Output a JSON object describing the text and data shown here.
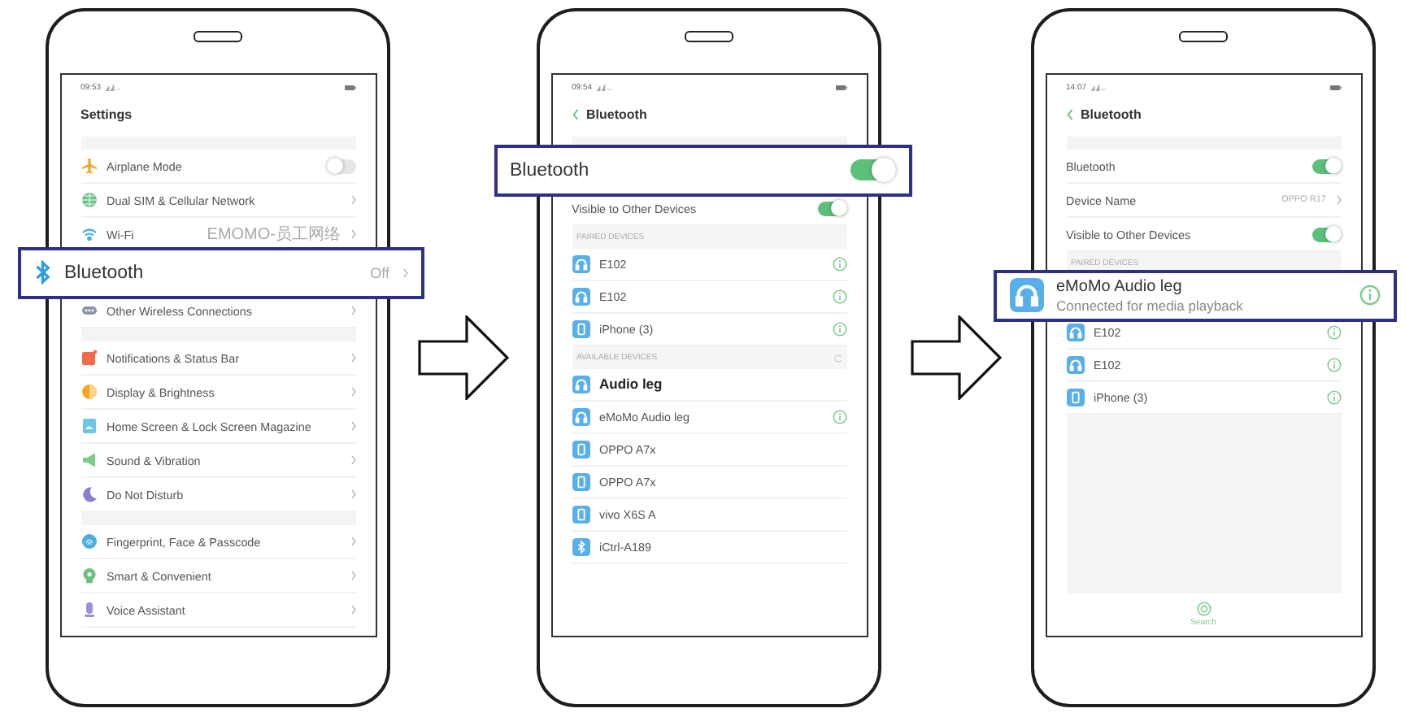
{
  "phones": [
    {
      "status_time": "09:53",
      "header": {
        "kind": "title",
        "title": "Settings"
      },
      "groups": [
        {
          "rows": [
            {
              "kind": "setting",
              "label": "Airplane Mode",
              "on": false
            },
            {
              "kind": "setting",
              "label": "Dual SIM & Cellular Network"
            },
            {
              "kind": "setting",
              "label": "Wi-Fi",
              "value": "EMOMO-员工网络"
            },
            {
              "kind": "bluetooth",
              "label": "Bluetooth",
              "value": "Off",
              "highlighted": true
            },
            {
              "kind": "setting",
              "label": "Other Wireless Connections"
            }
          ]
        },
        {
          "rows": [
            {
              "kind": "setting",
              "label": "Notifications & Status Bar"
            },
            {
              "kind": "setting",
              "label": "Display & Brightness"
            },
            {
              "kind": "setting",
              "label": "Home Screen & Lock Screen Magazine"
            },
            {
              "kind": "setting",
              "label": "Sound & Vibration"
            },
            {
              "kind": "setting",
              "label": "Do Not Disturb"
            }
          ]
        },
        {
          "rows": [
            {
              "kind": "setting",
              "label": "Fingerprint, Face & Passcode"
            },
            {
              "kind": "setting",
              "label": "Smart & Convenient"
            },
            {
              "kind": "setting",
              "label": "Voice Assistant"
            }
          ]
        }
      ]
    },
    {
      "status_time": "09:54",
      "header": {
        "kind": "back",
        "title": "Bluetooth"
      },
      "groups": [
        {
          "rows": [
            {
              "kind": "option",
              "label": "Bluetooth",
              "on": true,
              "highlighted": true
            },
            {
              "kind": "option",
              "label": "Visible to Other Devices",
              "on": true
            },
            {
              "kind": "section",
              "label": "PAIRED DEVICES"
            },
            {
              "kind": "headphones",
              "label": "E102",
              "info": true
            },
            {
              "kind": "headphones",
              "label": "E102",
              "info": true
            },
            {
              "kind": "phone",
              "label": "iPhone (3)",
              "info": true
            },
            {
              "kind": "section",
              "label": "AVAILABLE DEVICES",
              "refresh": true
            },
            {
              "kind": "headphones",
              "label": "Audio leg",
              "info": false,
              "bold": true
            },
            {
              "kind": "headphones",
              "label": "eMoMo Audio leg",
              "info": true
            },
            {
              "kind": "phone",
              "label": "OPPO A7x",
              "info": false
            },
            {
              "kind": "phone",
              "label": "OPPO A7x",
              "info": false
            },
            {
              "kind": "phone",
              "label": "vivo X6S A",
              "info": false
            },
            {
              "kind": "bluetooth",
              "label": "iCtrl-A189",
              "info": false
            }
          ]
        }
      ]
    },
    {
      "status_time": "14:07",
      "header": {
        "kind": "back",
        "title": "Bluetooth"
      },
      "groups": [
        {
          "rows": [
            {
              "kind": "option",
              "label": "Bluetooth",
              "on": true
            },
            {
              "kind": "option",
              "label": "Device Name",
              "value": "OPPO R17"
            },
            {
              "kind": "option",
              "label": "Visible to Other Devices",
              "on": true
            },
            {
              "kind": "section",
              "label": "PAIRED DEVICES"
            },
            {
              "kind": "headphones",
              "label": "eMoMo Audio leg",
              "subtitle": "Connected for media playback",
              "info": true,
              "highlighted": true
            },
            {
              "kind": "headphones",
              "label": "E102",
              "info": true
            },
            {
              "kind": "headphones",
              "label": "E102",
              "info": true
            },
            {
              "kind": "phone",
              "label": "iPhone (3)",
              "info": true
            }
          ]
        }
      ],
      "footer": {
        "label": "Search"
      }
    }
  ]
}
